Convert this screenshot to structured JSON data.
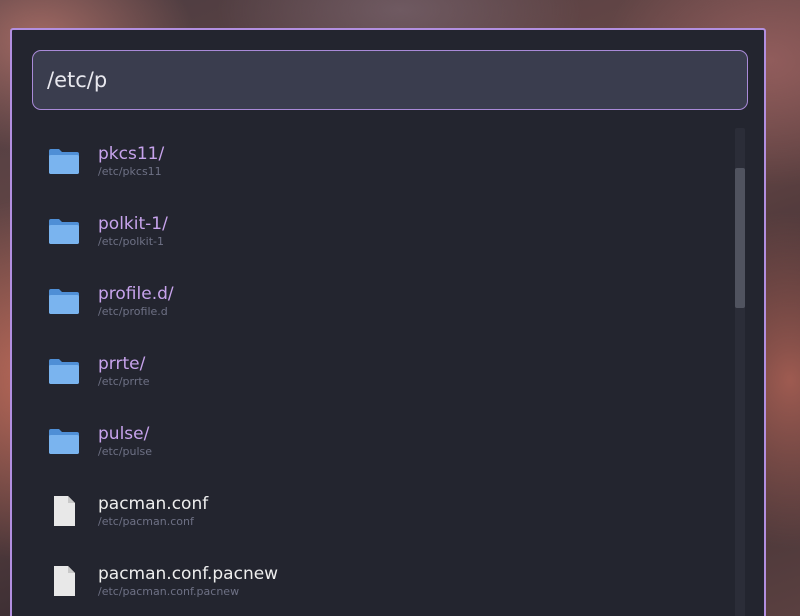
{
  "search": {
    "query": "/etc/p"
  },
  "results": [
    {
      "name": "pkcs11/",
      "path": "/etc/pkcs11",
      "kind": "folder",
      "icon": "folder-icon"
    },
    {
      "name": "polkit-1/",
      "path": "/etc/polkit-1",
      "kind": "folder",
      "icon": "folder-icon"
    },
    {
      "name": "profile.d/",
      "path": "/etc/profile.d",
      "kind": "folder",
      "icon": "folder-icon"
    },
    {
      "name": "prrte/",
      "path": "/etc/prrte",
      "kind": "folder",
      "icon": "folder-icon"
    },
    {
      "name": "pulse/",
      "path": "/etc/pulse",
      "kind": "folder",
      "icon": "folder-icon"
    },
    {
      "name": "pacman.conf",
      "path": "/etc/pacman.conf",
      "kind": "file",
      "icon": "file-icon"
    },
    {
      "name": "pacman.conf.pacnew",
      "path": "/etc/pacman.conf.pacnew",
      "kind": "file",
      "icon": "file-icon"
    }
  ],
  "colors": {
    "accent_border": "#b28fe0",
    "folder_label": "#c7a3ec",
    "file_label": "#eeeeee",
    "panel_bg": "#23252f",
    "search_bg": "#3a3d4e",
    "folder_icon": "#6aa6e8"
  }
}
